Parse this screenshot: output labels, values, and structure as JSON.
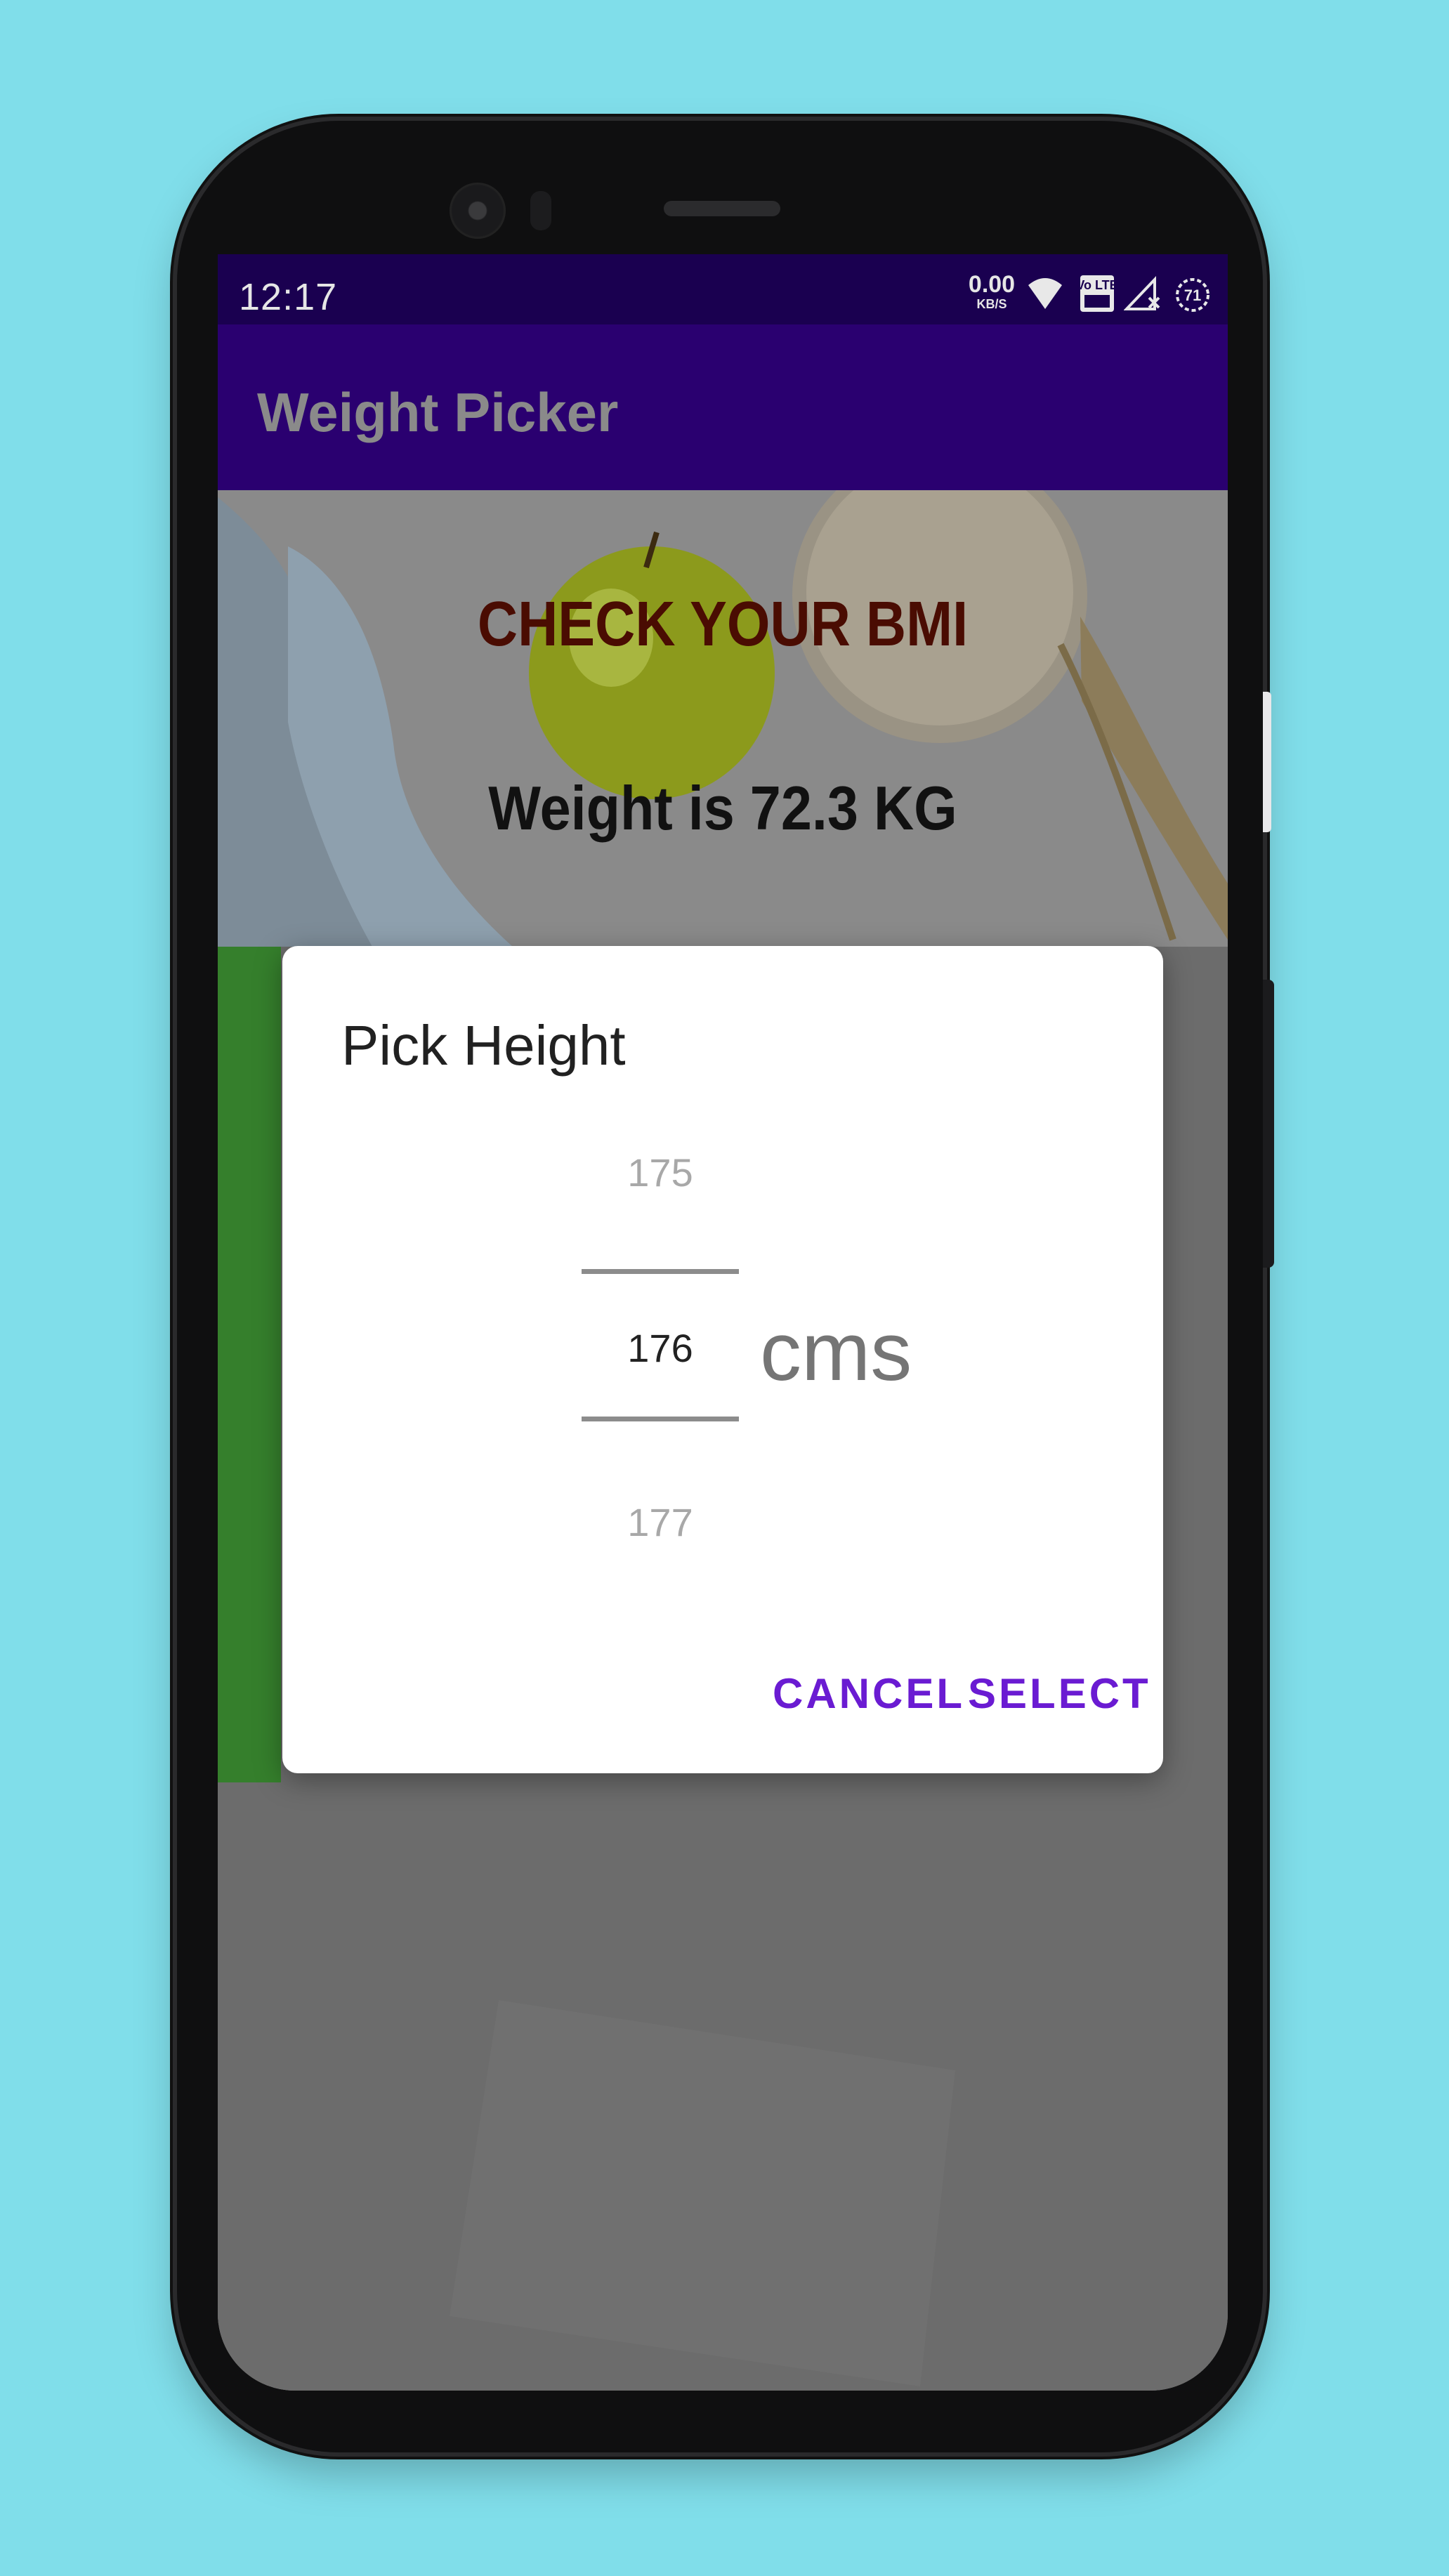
{
  "status_bar": {
    "time": "12:17",
    "net_speed": "0.00",
    "net_unit": "KB/S",
    "volte": "Vo LTE",
    "battery": "71"
  },
  "app": {
    "title": "Weight Picker"
  },
  "main": {
    "heading": "CHECK YOUR BMI",
    "weight_text": "Weight is 72.3 KG"
  },
  "dialog": {
    "title": "Pick Height",
    "picker": {
      "previous": "175",
      "current": "176",
      "next": "177",
      "unit": "cms"
    },
    "cancel_label": "CANCEL",
    "select_label": "SELECT"
  },
  "colors": {
    "background": "#80deea",
    "status_bar": "#1a0050",
    "toolbar": "#2a0070",
    "accent": "#6a1bd2",
    "scrim": "#6b6b6b"
  }
}
